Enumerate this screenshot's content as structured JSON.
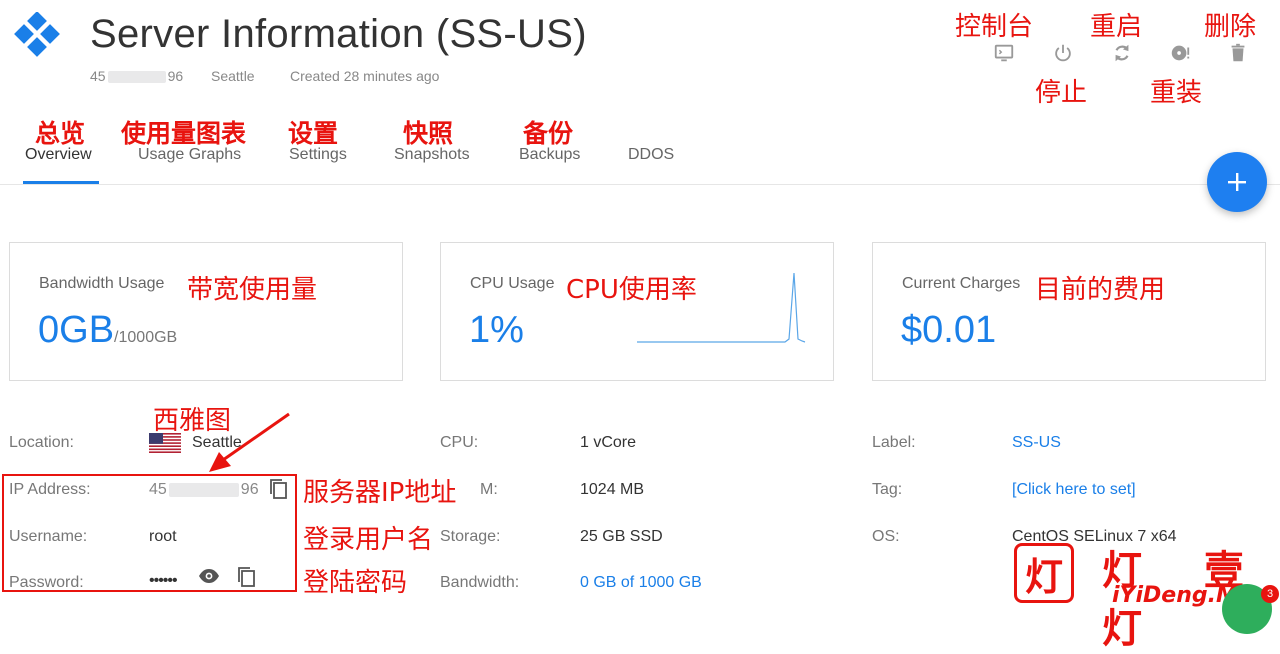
{
  "header": {
    "title": "Server Information (SS-US)",
    "ip_prefix": "45",
    "ip_suffix": "96",
    "location": "Seattle",
    "created": "Created 28 minutes ago"
  },
  "toolbar": {
    "annotations": {
      "console": "控制台",
      "restart": "重启",
      "delete": "删除",
      "stop": "停止",
      "reinstall": "重装"
    }
  },
  "tabs": [
    {
      "label": "Overview",
      "annotation": "总览"
    },
    {
      "label": "Usage Graphs",
      "annotation": "使用量图表"
    },
    {
      "label": "Settings",
      "annotation": "设置"
    },
    {
      "label": "Snapshots",
      "annotation": "快照"
    },
    {
      "label": "Backups",
      "annotation": "备份"
    },
    {
      "label": "DDOS",
      "annotation": ""
    }
  ],
  "cards": {
    "bandwidth": {
      "label": "Bandwidth Usage",
      "annotation": "带宽使用量",
      "value": "0GB",
      "sub": "/1000GB"
    },
    "cpu": {
      "label": "CPU Usage",
      "annotation": "CPU使用率",
      "value": "1%"
    },
    "charges": {
      "label": "Current Charges",
      "annotation": "目前的费用",
      "value": "$0.01"
    }
  },
  "info_left": {
    "location_label": "Location:",
    "location_value": "Seattle",
    "location_annotation": "西雅图",
    "ip_label": "IP Address:",
    "ip_prefix": "45",
    "ip_suffix": "96",
    "ip_annotation": "服务器IP地址",
    "username_label": "Username:",
    "username_value": "root",
    "username_annotation": "登录用户名",
    "password_label": "Password:",
    "password_value": "••••••",
    "password_annotation": "登陆密码"
  },
  "info_mid": {
    "cpu_label": "CPU:",
    "cpu_value": "1 vCore",
    "ram_label": "RAM:",
    "ram_value": "1024 MB",
    "storage_label": "Storage:",
    "storage_value": "25 GB SSD",
    "bandwidth_label": "Bandwidth:",
    "bandwidth_value": "0 GB of 1000 GB"
  },
  "info_right": {
    "label_label": "Label:",
    "label_value": "SS-US",
    "tag_label": "Tag:",
    "tag_value": "[Click here to set]",
    "os_label": "OS:",
    "os_value": "CentOS SELinux 7 x64"
  },
  "watermark": {
    "chars": "灯 壹 灯",
    "url": "iYiDeng.ME"
  },
  "chat_badge": "3",
  "colors": {
    "accent": "#1a7fe8",
    "annotation": "#e8140f",
    "fab": "#1e7ff0"
  }
}
